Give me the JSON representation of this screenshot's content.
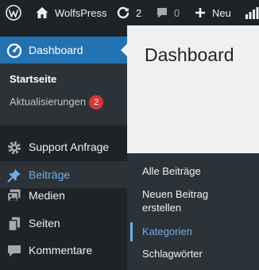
{
  "adminbar": {
    "site_name": "WolfsPress",
    "updates_count": "2",
    "comments_count": "0",
    "new_label": "Neu"
  },
  "sidebar": {
    "dashboard_label": "Dashboard",
    "dashboard_sub": {
      "home": "Startseite",
      "updates": "Aktualisierungen",
      "updates_badge": "2"
    },
    "support_label": "Support Anfrage",
    "posts_label": "Beiträge",
    "media_label": "Medien",
    "pages_label": "Seiten",
    "comments_label": "Kommentare"
  },
  "main": {
    "title": "Dashboard"
  },
  "posts_flyout": {
    "items": [
      "Alle Beiträge",
      "Neuen Beitrag erstellen",
      "Kategorien",
      "Schlagwörter"
    ]
  },
  "colors": {
    "adminbar_bg": "#1d2327",
    "sidebar_bg": "#1d2327",
    "submenu_bg": "#2c3338",
    "active_blue": "#2271b1",
    "link_blue": "#72aee6",
    "badge_red": "#d63638",
    "content_bg": "#f0f0f1"
  }
}
